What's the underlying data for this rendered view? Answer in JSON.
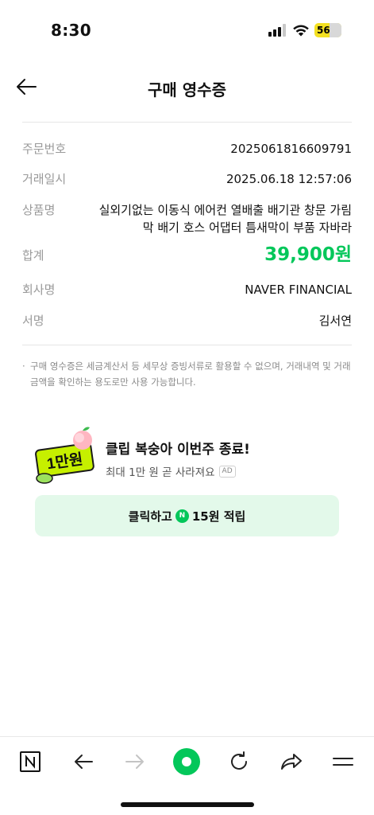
{
  "status": {
    "time": "8:30",
    "battery": "56"
  },
  "header": {
    "title": "구매 영수증"
  },
  "receipt": {
    "order_label": "주문번호",
    "order_value": "2025061816609791",
    "date_label": "거래일시",
    "date_value": "2025.06.18 12:57:06",
    "product_label": "상품명",
    "product_value": "실외기없는 이동식 에어컨 열배출 배기관 창문 가림막 배기 호스 어댑터 틈새막이 부품 자바라",
    "total_label": "합계",
    "total_value": "39,900원",
    "company_label": "회사명",
    "company_value": "NAVER FINANCIAL",
    "sign_label": "서명",
    "sign_value": "김서연",
    "notice": "구매 영수증은 세금계산서 등 세무상 증빙서류로 활용할 수 없으며, 거래내역 및 거래금액을 확인하는 용도로만 사용 가능합니다."
  },
  "promo": {
    "badge_text": "1만원",
    "title": "클립 복숭아 이번주 종료!",
    "subtitle": "최대 1만 원 곧 사라져요",
    "ad_tag": "AD",
    "button_prefix": "클릭하고",
    "coin_symbol": "N",
    "button_suffix": "15원 적립"
  },
  "toolbar": {
    "items": [
      "naver-home-icon",
      "back-arrow-icon",
      "forward-arrow-icon",
      "green-dot-icon",
      "refresh-icon",
      "share-icon",
      "menu-icon"
    ]
  },
  "colors": {
    "accent": "#03c75a",
    "promo_bg": "#e3f9ea",
    "badge": "#c6f000"
  }
}
